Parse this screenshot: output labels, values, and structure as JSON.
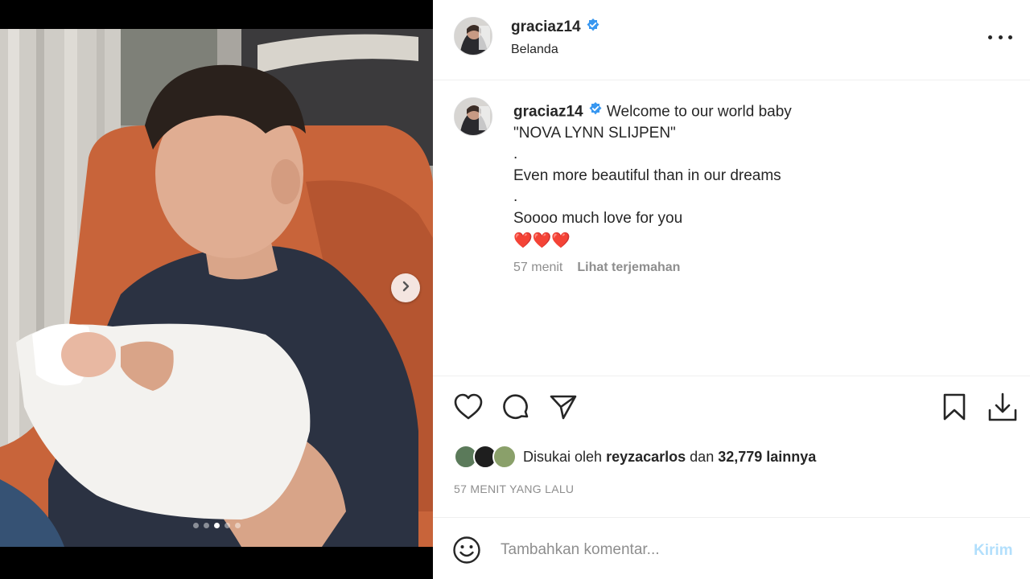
{
  "post": {
    "username": "graciaz14",
    "location": "Belanda",
    "caption": {
      "first_line": "Welcome to our world baby",
      "lines": [
        "\"NOVA LYNN SLIJPEN\"",
        ".",
        "Even more beautiful than in our dreams",
        ".",
        "Soooo much love for you"
      ],
      "hearts": "❤️❤️❤️"
    },
    "caption_age": "57 menit",
    "translate_label": "Lihat terjemahan",
    "liked_by_prefix": "Disukai oleh",
    "liked_by_user": "reyzacarlos",
    "liked_by_joiner": "dan",
    "liked_by_count": "32,779 lainnya",
    "timestamp": "57 MENIT YANG LALU",
    "carousel": {
      "total_slides": 5,
      "active_index": 2
    }
  },
  "comment": {
    "placeholder": "Tambahkan komentar...",
    "post_label": "Kirim"
  },
  "icons": {
    "verified": "verified-badge-icon",
    "more": "more-options-icon",
    "like": "heart-icon",
    "comment": "comment-icon",
    "share": "share-icon",
    "save": "bookmark-icon",
    "download": "download-icon",
    "emoji": "emoji-icon",
    "next": "chevron-right-icon"
  },
  "colors": {
    "verified_blue": "#3897f0",
    "text": "#262626",
    "muted": "#8e8e8e",
    "post_disabled": "#b2dffc"
  }
}
